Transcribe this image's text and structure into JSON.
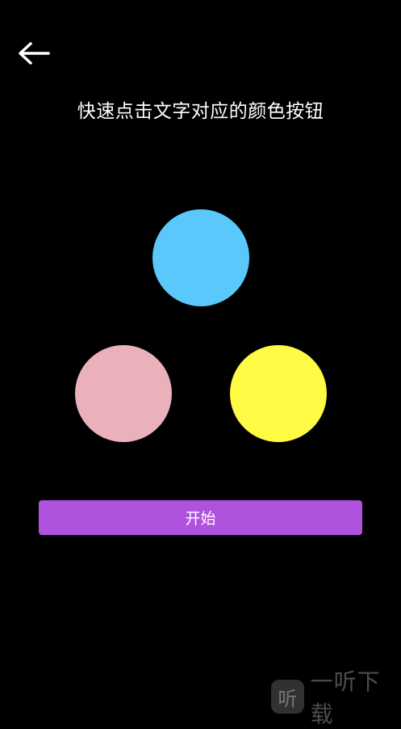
{
  "header": {
    "back_icon": "arrow-left-icon"
  },
  "instruction": {
    "text": "快速点击文字对应的颜色按钮"
  },
  "color_buttons": [
    {
      "color_name": "blue",
      "color": "#5AC8FA"
    },
    {
      "color_name": "pink",
      "color": "#EAB1BB"
    },
    {
      "color_name": "yellow",
      "color": "#FFFA44"
    }
  ],
  "start_button": {
    "label": "开始",
    "color": "#AF52DE"
  },
  "watermark": {
    "logo_glyph": "听",
    "text": "一听下载"
  }
}
